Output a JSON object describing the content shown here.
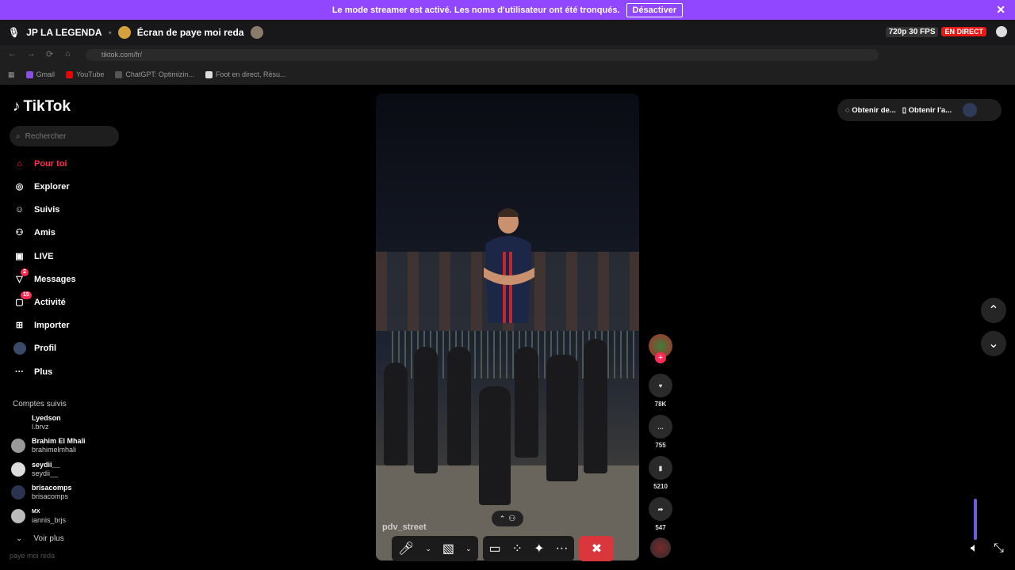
{
  "banner": {
    "message": "Le mode streamer est activé. Les noms d'utilisateur ont été tronqués.",
    "button": "Désactiver",
    "close": "✕"
  },
  "stream": {
    "channel": "JP LA LEGENDA",
    "window_title": "Écran de paye moi reda",
    "quality": "720p 30 FPS",
    "live": "EN DIRECT"
  },
  "browser": {
    "url": "tiktok.com/fr/",
    "bookmarks": [
      "Gmail",
      "YouTube",
      "ChatGPT: Optimizin...",
      "Foot en direct, Résu..."
    ]
  },
  "tiktok": {
    "logo": "TikTok",
    "search_placeholder": "Rechercher",
    "nav": [
      {
        "label": "Pour toi",
        "icon": "home-icon"
      },
      {
        "label": "Explorer",
        "icon": "compass-icon"
      },
      {
        "label": "Suivis",
        "icon": "user-plus-icon"
      },
      {
        "label": "Amis",
        "icon": "friends-icon"
      },
      {
        "label": "LIVE",
        "icon": "live-icon"
      },
      {
        "label": "Messages",
        "icon": "send-icon",
        "badge": "2"
      },
      {
        "label": "Activité",
        "icon": "inbox-icon",
        "badge": "15"
      },
      {
        "label": "Importer",
        "icon": "plus-square-icon"
      },
      {
        "label": "Profil",
        "icon": "avatar-icon"
      },
      {
        "label": "Plus",
        "icon": "more-icon"
      }
    ],
    "followed_title": "Comptes suivis",
    "accounts": [
      {
        "name": "Lyedson",
        "username": "l.brvz"
      },
      {
        "name": "Brahim El Mhali",
        "username": "brahimelmhali"
      },
      {
        "name": "seydii__",
        "username": "seydii__"
      },
      {
        "name": "brisacomps",
        "username": "brisacomps"
      },
      {
        "name": "MX",
        "username": "iannis_brjs"
      }
    ],
    "see_more": "Voir plus",
    "top_right": {
      "get_coins": "Obtenir de...",
      "get_app": "Obtenir l'a..."
    },
    "video": {
      "author": "pdv_street",
      "likes": "78K",
      "comments": "755",
      "saves": "5210",
      "shares": "547"
    }
  },
  "bottom_tab": "paye moi reda",
  "colors": {
    "banner": "#9147ff",
    "tiktok_accent": "#fe2c55",
    "end_call": "#da373c"
  }
}
